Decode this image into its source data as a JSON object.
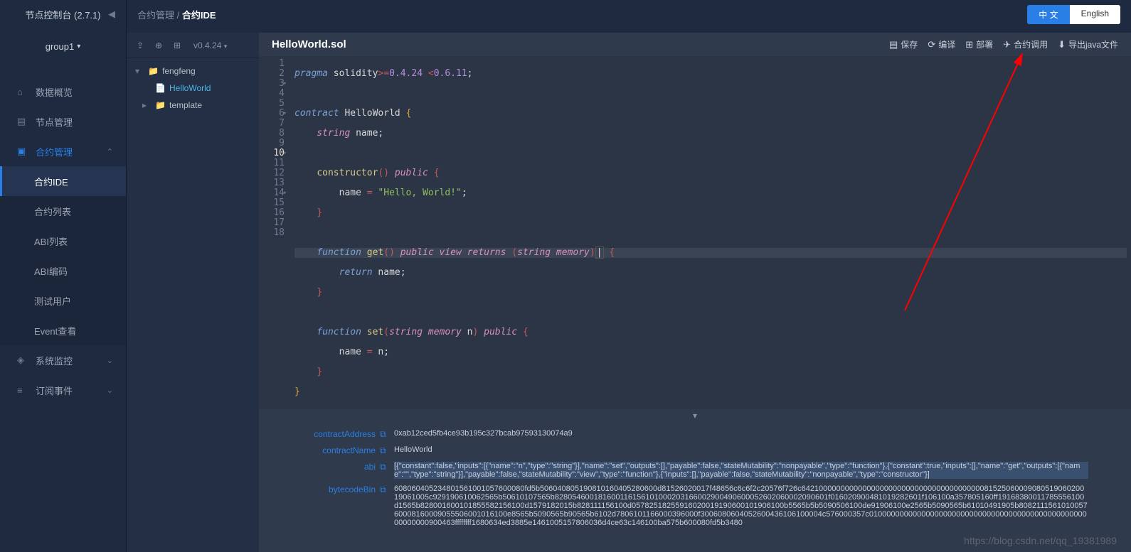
{
  "sidebar": {
    "title": "节点控制台 (2.7.1)",
    "group": "group1",
    "items": [
      {
        "icon": "⌂",
        "label": "数据概览"
      },
      {
        "icon": "▤",
        "label": "节点管理"
      },
      {
        "icon": "▣",
        "label": "合约管理",
        "active": true,
        "expanded": true,
        "children": [
          {
            "label": "合约IDE",
            "active": true
          },
          {
            "label": "合约列表"
          },
          {
            "label": "ABI列表"
          },
          {
            "label": "ABI编码"
          },
          {
            "label": "测试用户"
          },
          {
            "label": "Event查看"
          }
        ]
      },
      {
        "icon": "◈",
        "label": "系统监控",
        "chevron": "⌄"
      },
      {
        "icon": "≡",
        "label": "订阅事件",
        "chevron": "⌄"
      }
    ]
  },
  "header": {
    "breadcrumb": {
      "parent": "合约管理",
      "current": "合约IDE"
    },
    "lang": {
      "zh": "中 文",
      "en": "English"
    }
  },
  "filePanel": {
    "version": "v0.4.24",
    "tree": [
      {
        "type": "folder",
        "name": "fengfeng",
        "expanded": true,
        "children": [
          {
            "type": "file",
            "name": "HelloWorld",
            "active": true
          }
        ]
      },
      {
        "type": "folder",
        "name": "template",
        "expanded": false
      }
    ]
  },
  "editor": {
    "filename": "HelloWorld.sol",
    "actions": [
      {
        "icon": "▤",
        "label": "保存"
      },
      {
        "icon": "⟳",
        "label": "编译"
      },
      {
        "icon": "⊞",
        "label": "部署"
      },
      {
        "icon": "✈",
        "label": "合约调用",
        "highlight": true
      },
      {
        "icon": "⬇",
        "label": "导出java文件"
      }
    ],
    "lineCount": 18,
    "highlightLine": 10
  },
  "bottom": {
    "rows": [
      {
        "label": "contractAddress",
        "value": "0xab12ced5fb4ce93b195c327bcab97593130074a9"
      },
      {
        "label": "contractName",
        "value": "HelloWorld"
      },
      {
        "label": "abi",
        "value": "[{\"constant\":false,\"inputs\":[{\"name\":\"n\",\"type\":\"string\"}],\"name\":\"set\",\"outputs\":[],\"payable\":false,\"stateMutability\":\"nonpayable\",\"type\":\"function\"},{\"constant\":true,\"inputs\":[],\"name\":\"get\",\"outputs\":[{\"name\":\"\",\"type\":\"string\"}],\"payable\":false,\"stateMutability\":\"view\",\"type\":\"function\"},{\"inputs\":[],\"payable\":false,\"stateMutability\":\"nonpayable\",\"type\":\"constructor\"}]",
        "hl": true
      },
      {
        "label": "bytecodeBin",
        "value": "608060405234801561001057600080fd5b506040805190810160405280600d81526020017f48656c6c6f2c20576f726c6421000000000000000000000000000000000000008152506000908051906020019061005c929190610062565b50610107565b828054600181600116156101000203166002900490600052602060002090601f016020900481019282601f106100a357805160ff19168380011785556100d1565b828001600101855582156100d1579182015b828111156100d05782518255916020019190600101906100b5565b5b5090506100de91906100e2565b5090565b61010491905b808211156101005760008160009055506001016100e8565b5090565b90565b6102d7806101166000396000f3006080604052600436106100004c576000357c0100000000000000000000000000000000000000000000000000000000900463ffffffff1680634ed3885e1461005157806036d4ce63c146100ba575b600080fd5b3480"
      }
    ]
  },
  "watermark": "https://blog.csdn.net/qq_19381989"
}
